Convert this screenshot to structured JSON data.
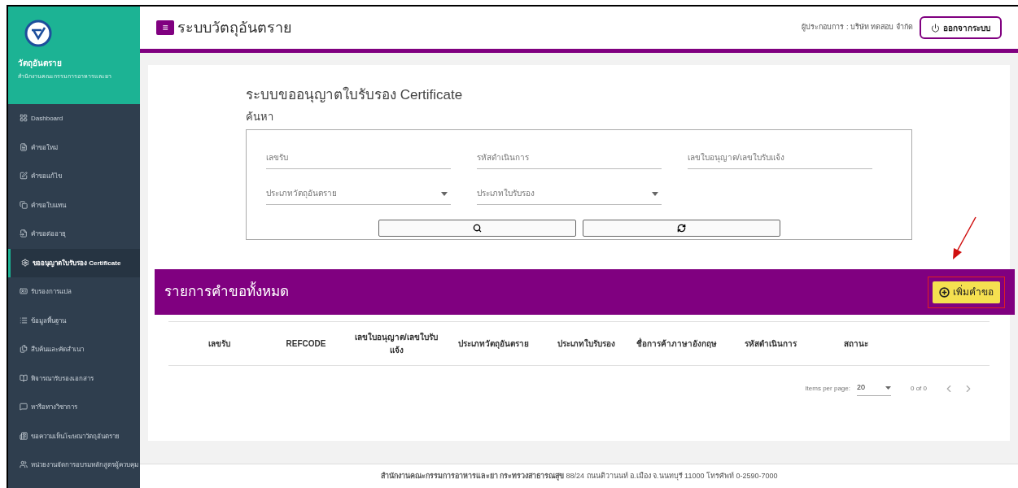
{
  "sidebar": {
    "brand_title": "วัตถุอันตราย",
    "brand_subtitle": "สำนักงานคณะกรรมการอาหารและยา",
    "items": [
      {
        "label": "Dashboard",
        "selected": false
      },
      {
        "label": "คำขอใหม่",
        "selected": false
      },
      {
        "label": "คำขอแก้ไข",
        "selected": false
      },
      {
        "label": "คำขอใบแทน",
        "selected": false
      },
      {
        "label": "คำขอต่ออายุ",
        "selected": false
      },
      {
        "label": "ขออนุญาตใบรับรอง Certificate",
        "selected": true
      },
      {
        "label": "รับรองการแปล",
        "selected": false
      },
      {
        "label": "ข้อมูลพื้นฐาน",
        "selected": false
      },
      {
        "label": "สืบค้นและคัดสำเนา",
        "selected": false
      },
      {
        "label": "พิจารณารับรองเอกสาร",
        "selected": false
      },
      {
        "label": "หารือทางวิชาการ",
        "selected": false
      },
      {
        "label": "ขอความเห็นโฆษณาวัตถุอันตราย",
        "selected": false
      },
      {
        "label": "หน่วยงานจัดการอบรมหลักสูตรผู้ควบคุม",
        "selected": false
      }
    ]
  },
  "header": {
    "menu_icon": "≡",
    "title": "ระบบวัตถุอันตราย",
    "operator": "ผู้ประกอบการ : บริษัท ทดสอบ จำกัด",
    "logout": "ออกจากระบบ"
  },
  "search": {
    "page_title": "ระบบขออนุญาตใบรับรอง Certificate",
    "section_title": "ค้นหา",
    "fields": [
      {
        "kind": "text",
        "placeholder": "เลขรับ"
      },
      {
        "kind": "text",
        "placeholder": "รหัสดำเนินการ"
      },
      {
        "kind": "text",
        "placeholder": "เลขใบอนุญาต/เลขใบรับแจ้ง"
      },
      {
        "kind": "select",
        "placeholder": "ประเภทวัตถุอันตราย"
      },
      {
        "kind": "select",
        "placeholder": "ประเภทใบรับรอง"
      }
    ]
  },
  "list": {
    "title": "รายการคำขอทั้งหมด",
    "add_button": "เพิ่มคำขอ",
    "columns": [
      "เลขรับ",
      "REFCODE",
      "เลขใบอนุญาต/เลขใบรับแจ้ง",
      "ประเภทวัตถุอันตราย",
      "ประเภทใบรับรอง",
      "ชื่อการค้าภาษาอังกฤษ",
      "รหัสดำเนินการ",
      "สถานะ"
    ],
    "paginator": {
      "label": "Items per page:",
      "page_size": "20",
      "range": "0 of 0",
      "prev_disabled": true,
      "next_disabled": true
    }
  },
  "footer": {
    "text": "**สำนักงานคณะกรรมการอาหารและยา กระทรวงสาธารณสุข** 88/24 ถนนติวานนท์ อ.เมือง จ.นนทบุรี 11000 โทรศัพท์ 0-2590-7000"
  }
}
